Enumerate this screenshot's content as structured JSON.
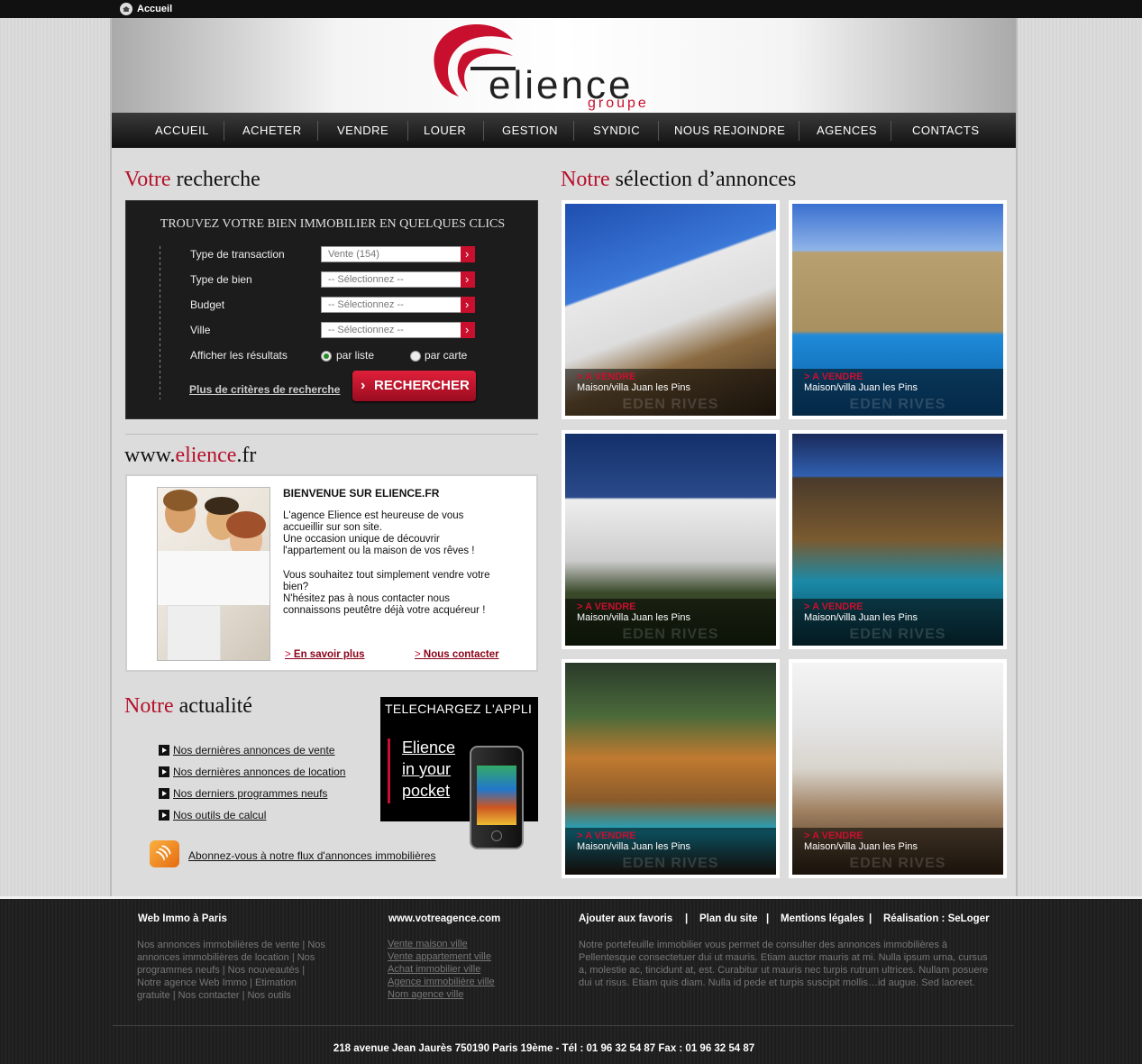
{
  "topbar": {
    "home_label": "Accueil"
  },
  "logo": {
    "word": "elience",
    "sub": "groupe"
  },
  "nav": [
    "ACCUEIL",
    "ACHETER",
    "VENDRE",
    "LOUER",
    "GESTION",
    "SYNDIC",
    "NOUS REJOINDRE",
    "AGENCES",
    "CONTACTS"
  ],
  "search_title": {
    "accent": "Votre",
    "rest": " recherche"
  },
  "search": {
    "heading": "TROUVEZ VOTRE BIEN IMMOBILIER EN QUELQUES CLICS",
    "transaction_label": "Type de transaction",
    "transaction_value": "Vente (154)",
    "bien_label": "Type de bien",
    "bien_value": "-- Sélectionnez --",
    "budget_label": "Budget",
    "budget_value": "-- Sélectionnez --",
    "ville_label": "Ville",
    "ville_value": "-- Sélectionnez --",
    "display_label": "Afficher les résultats",
    "opt_list": "par liste",
    "opt_map": "par carte",
    "more_link": "Plus de critères de recherche",
    "button": "RECHERCHER"
  },
  "site_title": {
    "pre": "www.",
    "accent": "elience",
    "post": ".fr"
  },
  "welcome": {
    "title": "BIENVENUE SUR ELIENCE.FR",
    "p1": "L'agence Elience est heureuse de vous accueillir sur son site.\nUne occasion unique de découvrir l'appartement ou la maison de vos rêves !",
    "p2": "Vous souhaitez tout simplement vendre votre bien?\nN'hésitez pas à nous contacter nous connaissons peutêtre déjà votre acquéreur !",
    "link_more": "En savoir plus",
    "link_contact": "Nous contacter"
  },
  "news_title": {
    "accent": "Notre",
    "rest": " actualité"
  },
  "news": [
    "Nos dernières annonces de vente",
    "Nos dernières annonces de location",
    "Nos derniers programmes neufs",
    "Nos outils de calcul "
  ],
  "app": {
    "title": "TELECHARGEZ L'APPLI",
    "line1": "Elience",
    "line2": "in your",
    "line3": "pocket"
  },
  "rss": "Abonnez-vous à notre flux d'annonces immobilières",
  "listings_title": {
    "accent": "Notre",
    "rest": " sélection d’annonces"
  },
  "listings": [
    {
      "status": "> A VENDRE",
      "desc": "Maison/villa Juan les Pins",
      "watermark": "EDEN RIVES"
    },
    {
      "status": "> A VENDRE",
      "desc": "Maison/villa Juan les Pins",
      "watermark": "EDEN RIVES"
    },
    {
      "status": "> A VENDRE",
      "desc": "Maison/villa Juan les Pins",
      "watermark": "EDEN RIVES"
    },
    {
      "status": "> A VENDRE",
      "desc": "Maison/villa Juan les Pins",
      "watermark": "EDEN RIVES"
    },
    {
      "status": "> A VENDRE",
      "desc": "Maison/villa Juan les Pins",
      "watermark": "EDEN RIVES"
    },
    {
      "status": "> A VENDRE",
      "desc": "Maison/villa Juan les Pins",
      "watermark": "EDEN RIVES"
    }
  ],
  "footer": {
    "col1_title": "Web Immo à Paris",
    "col1_text": "Nos annonces immobilières de vente | Nos annonces immobilières de location | Nos programmes neufs | Nos nouveautés | Notre agence Web Immo | Etimation gratuite | Nos contacter | Nos outils",
    "col2_title": "www.votreagence.com",
    "col2_links": [
      "Vente maison ville",
      "Vente appartement ville",
      "Achat immobilier ville",
      "Agence immobilière ville",
      "Nom agence ville"
    ],
    "col3_links": [
      "Ajouter aux favoris",
      "Plan du site",
      "Mentions légales",
      "Réalisation : SeLoger"
    ],
    "col3_text": "Notre portefeuille immobilier vous permet de consulter des annonces immobilières à Pellentesque consectetuer dui ut mauris. Etiam auctor mauris at mi. Nulla ipsum urna, cursus a, molestie ac, tincidunt at, est. Curabitur ut mauris nec turpis rutrum ultrices. Nullam posuere dui ut risus. Etiam quis diam. Nulla id pede et turpis suscipit mollis…id augue. Sed laoreet.",
    "address": "218 avenue Jean Jaurès 750190 Paris 19ème -  Tél : 01 96 32 54 87  Fax : 01 96 32 54 87"
  },
  "colors": {
    "accent": "#c8102e",
    "dark": "#1c1c1c"
  }
}
